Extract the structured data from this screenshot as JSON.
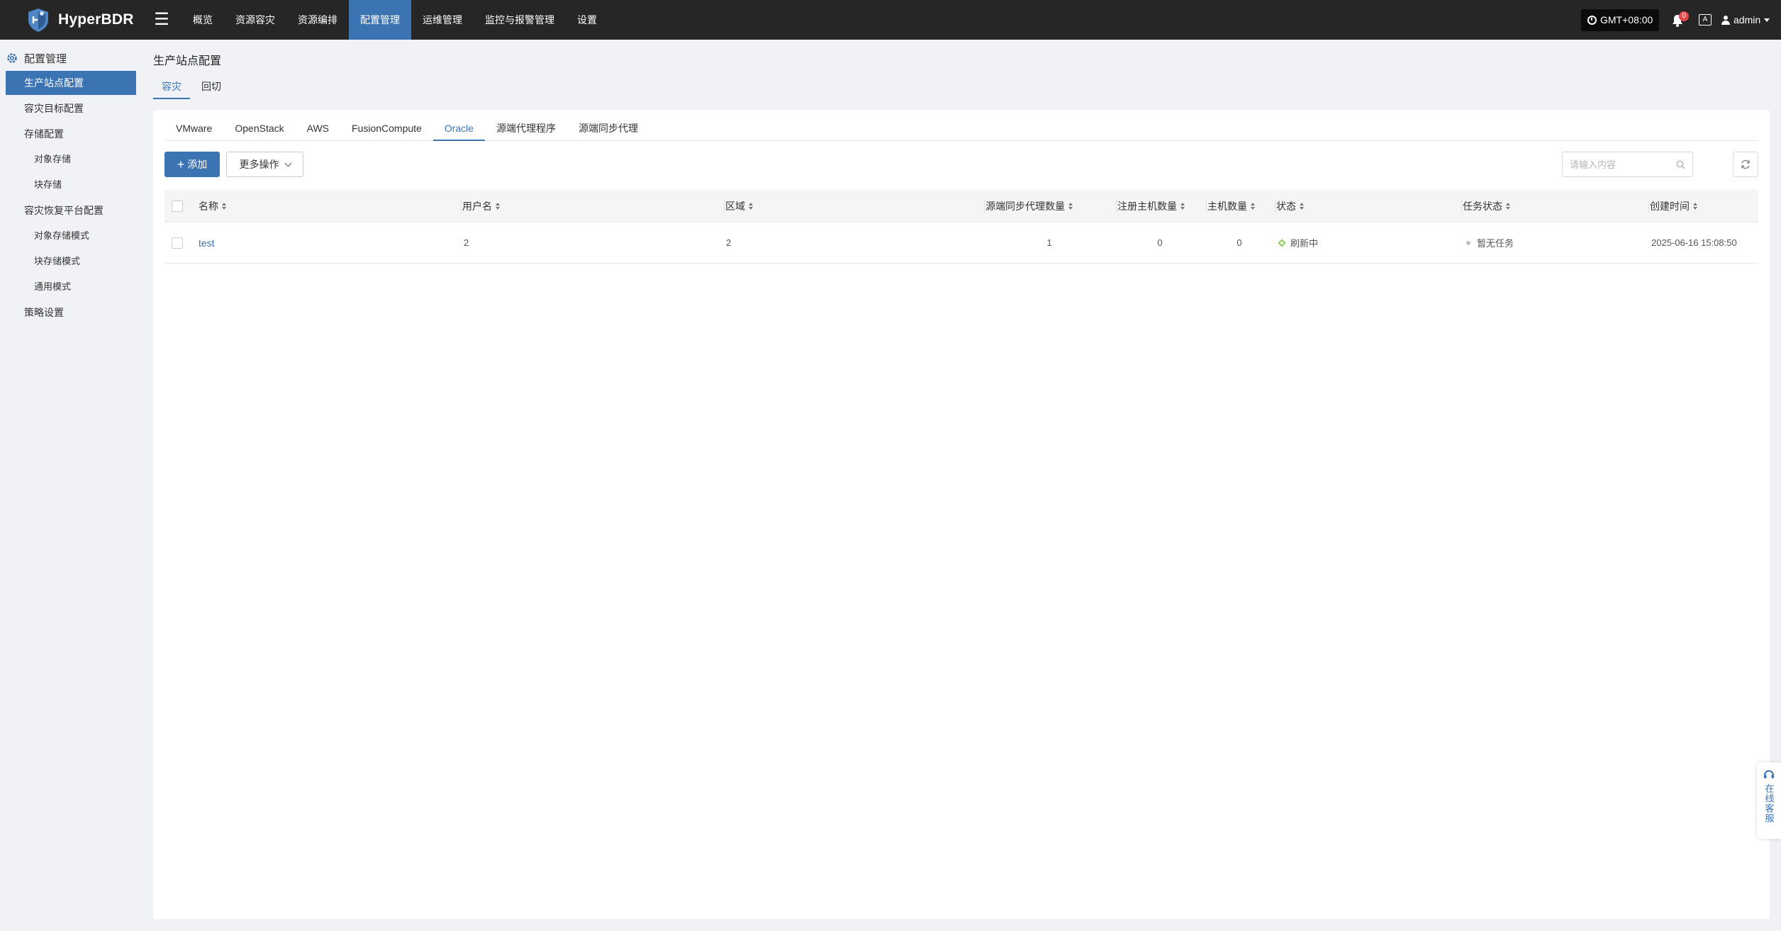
{
  "app": {
    "name": "HyperBDR"
  },
  "nav": {
    "items": [
      "概览",
      "资源容灾",
      "资源编排",
      "配置管理",
      "运维管理",
      "监控与报警管理",
      "设置"
    ],
    "active": "配置管理",
    "timezone": "GMT+08:00",
    "notification_count": "0",
    "lang_label": "A",
    "user": "admin"
  },
  "sidebar": {
    "header": "配置管理",
    "items": [
      {
        "label": "生产站点配置",
        "level": 1,
        "active": true
      },
      {
        "label": "容灾目标配置",
        "level": 1
      },
      {
        "label": "存储配置",
        "level": 1
      },
      {
        "label": "对象存储",
        "level": 2
      },
      {
        "label": "块存储",
        "level": 2
      },
      {
        "label": "容灾恢复平台配置",
        "level": 1
      },
      {
        "label": "对象存储模式",
        "level": 2
      },
      {
        "label": "块存储模式",
        "level": 2
      },
      {
        "label": "通用模式",
        "level": 2
      },
      {
        "label": "策略设置",
        "level": 1
      }
    ]
  },
  "page": {
    "title": "生产站点配置",
    "tabs": [
      "容灾",
      "回切"
    ],
    "active_tab": "容灾",
    "sub_tabs": [
      "VMware",
      "OpenStack",
      "AWS",
      "FusionCompute",
      "Oracle",
      "源端代理程序",
      "源端同步代理"
    ],
    "active_sub_tab": "Oracle"
  },
  "toolbar": {
    "add_label": "添加",
    "more_label": "更多操作",
    "search_placeholder": "请输入内容"
  },
  "table": {
    "columns": [
      "名称",
      "用户名",
      "区域",
      "源端同步代理数量",
      "注册主机数量",
      "主机数量",
      "状态",
      "任务状态",
      "创建时间"
    ],
    "rows": [
      {
        "name": "test",
        "username": "2",
        "region": "2",
        "sync_proxy_count": "1",
        "registered_hosts": "0",
        "hosts": "0",
        "status": "刷新中",
        "task_status": "暂无任务",
        "created": "2025-06-16 15:08:50"
      }
    ]
  },
  "service": {
    "label": "在线客服"
  },
  "colors": {
    "accent": "#3c74b3",
    "topbar": "#262626",
    "status_refreshing": "#7ac943"
  }
}
